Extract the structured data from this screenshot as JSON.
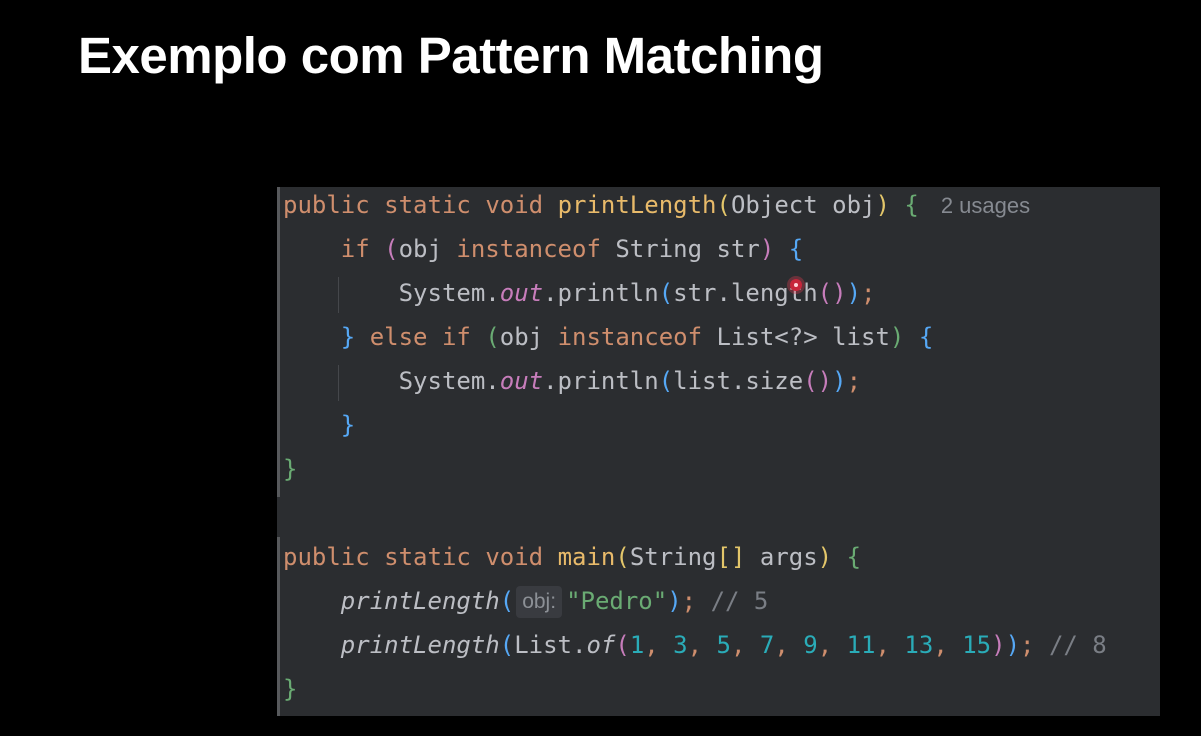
{
  "slide": {
    "title": "Exemplo com Pattern Matching"
  },
  "editor": {
    "lines": [
      {
        "tokens": [
          {
            "t": "public",
            "c": "kw"
          },
          {
            "t": " ",
            "c": ""
          },
          {
            "t": "static",
            "c": "kw"
          },
          {
            "t": " ",
            "c": ""
          },
          {
            "t": "void",
            "c": "kw"
          },
          {
            "t": " ",
            "c": ""
          },
          {
            "t": "printLength",
            "c": "dname"
          },
          {
            "t": "(",
            "c": "b1"
          },
          {
            "t": "Object obj",
            "c": "ident"
          },
          {
            "t": ")",
            "c": "b1"
          },
          {
            "t": " ",
            "c": ""
          },
          {
            "t": "{",
            "c": "b4"
          }
        ],
        "hint": "2 usages"
      },
      {
        "tokens": [
          {
            "t": "    ",
            "c": ""
          },
          {
            "t": "if",
            "c": "kw"
          },
          {
            "t": " ",
            "c": ""
          },
          {
            "t": "(",
            "c": "b2"
          },
          {
            "t": "obj ",
            "c": "ident"
          },
          {
            "t": "instanceof",
            "c": "kw"
          },
          {
            "t": " String str",
            "c": "ident"
          },
          {
            "t": ")",
            "c": "b2"
          },
          {
            "t": " ",
            "c": ""
          },
          {
            "t": "{",
            "c": "b3"
          }
        ]
      },
      {
        "tokens": [
          {
            "t": "        ",
            "c": ""
          },
          {
            "t": "System.",
            "c": "ident"
          },
          {
            "t": "out",
            "c": "static-field"
          },
          {
            "t": ".println",
            "c": "ident"
          },
          {
            "t": "(",
            "c": "b3"
          },
          {
            "t": "str.length",
            "c": "ident"
          },
          {
            "t": "()",
            "c": "b2"
          },
          {
            "t": ")",
            "c": "b3"
          },
          {
            "t": ";",
            "c": "kw"
          }
        ]
      },
      {
        "tokens": [
          {
            "t": "    ",
            "c": ""
          },
          {
            "t": "}",
            "c": "b3"
          },
          {
            "t": " ",
            "c": ""
          },
          {
            "t": "else",
            "c": "kw"
          },
          {
            "t": " ",
            "c": ""
          },
          {
            "t": "if",
            "c": "kw"
          },
          {
            "t": " ",
            "c": ""
          },
          {
            "t": "(",
            "c": "b4"
          },
          {
            "t": "obj ",
            "c": "ident"
          },
          {
            "t": "instanceof",
            "c": "kw"
          },
          {
            "t": " List<?> list",
            "c": "ident"
          },
          {
            "t": ")",
            "c": "b4"
          },
          {
            "t": " ",
            "c": ""
          },
          {
            "t": "{",
            "c": "b3"
          }
        ]
      },
      {
        "tokens": [
          {
            "t": "        ",
            "c": ""
          },
          {
            "t": "System.",
            "c": "ident"
          },
          {
            "t": "out",
            "c": "static-field"
          },
          {
            "t": ".println",
            "c": "ident"
          },
          {
            "t": "(",
            "c": "b3"
          },
          {
            "t": "list.size",
            "c": "ident"
          },
          {
            "t": "()",
            "c": "b2"
          },
          {
            "t": ")",
            "c": "b3"
          },
          {
            "t": ";",
            "c": "kw"
          }
        ]
      },
      {
        "tokens": [
          {
            "t": "    ",
            "c": ""
          },
          {
            "t": "}",
            "c": "b3"
          }
        ]
      },
      {
        "tokens": [
          {
            "t": "}",
            "c": "b4"
          }
        ]
      },
      {
        "tokens": []
      },
      {
        "tokens": [
          {
            "t": "public",
            "c": "kw"
          },
          {
            "t": " ",
            "c": ""
          },
          {
            "t": "static",
            "c": "kw"
          },
          {
            "t": " ",
            "c": ""
          },
          {
            "t": "void",
            "c": "kw"
          },
          {
            "t": " ",
            "c": ""
          },
          {
            "t": "main",
            "c": "dname"
          },
          {
            "t": "(",
            "c": "b1"
          },
          {
            "t": "String",
            "c": "ident"
          },
          {
            "t": "[]",
            "c": "b1"
          },
          {
            "t": " args",
            "c": "ident"
          },
          {
            "t": ")",
            "c": "b1"
          },
          {
            "t": " ",
            "c": ""
          },
          {
            "t": "{",
            "c": "b4"
          }
        ]
      },
      {
        "tokens": [
          {
            "t": "    ",
            "c": ""
          },
          {
            "t": "printLength",
            "c": "ident static-call"
          },
          {
            "t": "(",
            "c": "b3"
          },
          {
            "t": "obj:",
            "c": "param-hint"
          },
          {
            "t": "\"Pedro\"",
            "c": "str"
          },
          {
            "t": ")",
            "c": "b3"
          },
          {
            "t": ";",
            "c": "kw"
          },
          {
            "t": " // 5",
            "c": "comment"
          }
        ]
      },
      {
        "tokens": [
          {
            "t": "    ",
            "c": ""
          },
          {
            "t": "printLength",
            "c": "ident static-call"
          },
          {
            "t": "(",
            "c": "b3"
          },
          {
            "t": "List.",
            "c": "ident"
          },
          {
            "t": "of",
            "c": "ident static-call"
          },
          {
            "t": "(",
            "c": "b2"
          },
          {
            "t": "1",
            "c": "num"
          },
          {
            "t": ", ",
            "c": "kw"
          },
          {
            "t": "3",
            "c": "num"
          },
          {
            "t": ", ",
            "c": "kw"
          },
          {
            "t": "5",
            "c": "num"
          },
          {
            "t": ", ",
            "c": "kw"
          },
          {
            "t": "7",
            "c": "num"
          },
          {
            "t": ", ",
            "c": "kw"
          },
          {
            "t": "9",
            "c": "num"
          },
          {
            "t": ", ",
            "c": "kw"
          },
          {
            "t": "11",
            "c": "num"
          },
          {
            "t": ", ",
            "c": "kw"
          },
          {
            "t": "13",
            "c": "num"
          },
          {
            "t": ", ",
            "c": "kw"
          },
          {
            "t": "15",
            "c": "num"
          },
          {
            "t": ")",
            "c": "b2"
          },
          {
            "t": ")",
            "c": "b3"
          },
          {
            "t": ";",
            "c": "kw"
          },
          {
            "t": " // 8",
            "c": "comment"
          }
        ]
      },
      {
        "tokens": [
          {
            "t": "}",
            "c": "b4"
          }
        ]
      }
    ]
  },
  "colors": {
    "background": "#000000",
    "editor_background": "#2b2d30",
    "keyword": "#cf8e6d",
    "declaration": "#e8ba6a",
    "identifier": "#bcbec4",
    "static_field": "#c77dbb",
    "string": "#6aab73",
    "number": "#2aacb8",
    "comment": "#7a7e85"
  }
}
